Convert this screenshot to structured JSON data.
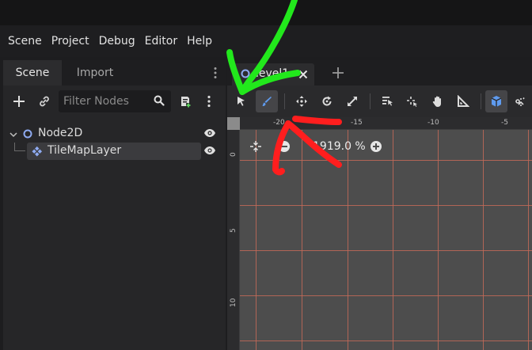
{
  "menubar": {
    "items": [
      "Scene",
      "Project",
      "Debug",
      "Editor",
      "Help"
    ]
  },
  "scene_dock": {
    "tabs": [
      "Scene",
      "Import"
    ],
    "filter_placeholder": "Filter Nodes",
    "tree": [
      {
        "label": "Node2D",
        "icon": "node2d-icon"
      },
      {
        "label": "TileMapLayer",
        "icon": "tilemaplayer-icon"
      }
    ]
  },
  "editor": {
    "scene_tab": "level1",
    "zoom_label": "1919.0 %",
    "ruler_top": [
      "-20",
      "-15",
      "-10",
      "-5"
    ],
    "ruler_left": [
      "0",
      "5",
      "10"
    ]
  },
  "colors": {
    "accent": "#5f9bef",
    "annotation_green": "#22e81c",
    "annotation_red": "#ff1e1e",
    "grid_line": "#c36a58"
  }
}
